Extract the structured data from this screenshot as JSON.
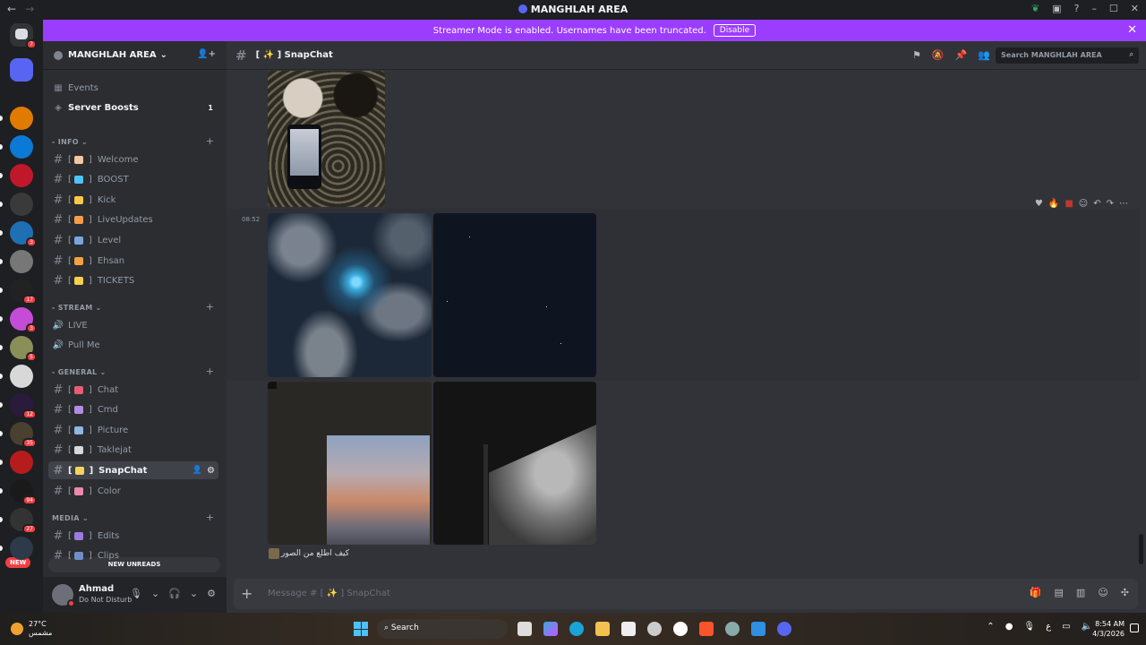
{
  "window": {
    "title": "MANGHLAH AREA",
    "back": "←",
    "forward": "→"
  },
  "banner": {
    "text": "Streamer Mode is enabled. Usernames have been truncated.",
    "disable_label": "Disable",
    "close": "✕"
  },
  "servers": {
    "dm_badge": "7",
    "new_label": "NEW",
    "items": [
      {
        "badge": "",
        "color": "#5865f2"
      },
      {
        "badge": "",
        "color": "#e07b00"
      },
      {
        "badge": "",
        "color": "#0b79d6"
      },
      {
        "badge": "",
        "color": "#c0182b"
      },
      {
        "badge": "",
        "color": "#3a3a3a"
      },
      {
        "badge": "3",
        "color": "#1f6fb5"
      },
      {
        "badge": "",
        "color": "#777777"
      },
      {
        "badge": "17",
        "color": "#222222"
      },
      {
        "badge": "3",
        "color": "#c44cd6"
      },
      {
        "badge": "5",
        "color": "#8a8f5a"
      },
      {
        "badge": "",
        "color": "#d8d8d8"
      },
      {
        "badge": "12",
        "color": "#2a1b3d"
      },
      {
        "badge": "35",
        "color": "#4a4030"
      },
      {
        "badge": "",
        "color": "#b71c1c"
      },
      {
        "badge": "94",
        "color": "#1a1a1a"
      },
      {
        "badge": "27",
        "color": "#333333"
      },
      {
        "badge": "",
        "color": "#2d3a4a"
      }
    ]
  },
  "guild": {
    "name": "MANGHLAH AREA",
    "chevron": "⌄"
  },
  "sidebar": {
    "events": "Events",
    "boosts": "Server Boosts",
    "boosts_count": "1",
    "cat_info": "INFO",
    "info_channels": [
      {
        "label": "Welcome",
        "emoji_color": "#f3c7a1"
      },
      {
        "label": "BOOST",
        "emoji_color": "#4fc3f7"
      },
      {
        "label": "Kick",
        "emoji_color": "#f9c846"
      },
      {
        "label": "LiveUpdates",
        "emoji_color": "#f39c4a"
      },
      {
        "label": "Level",
        "emoji_color": "#7aa6e0"
      },
      {
        "label": "Ehsan",
        "emoji_color": "#f5a142"
      },
      {
        "label": "TICKETS",
        "emoji_color": "#f6d04d"
      }
    ],
    "cat_stream": "STREAM",
    "stream_channels": [
      "LIVE",
      "Pull Me"
    ],
    "cat_general": "GENERAL",
    "general_channels": [
      {
        "label": "Chat",
        "emoji_color": "#e85d75"
      },
      {
        "label": "Cmd",
        "emoji_color": "#b08de0"
      },
      {
        "label": "Picture",
        "emoji_color": "#8fb7e0"
      },
      {
        "label": "Taklejat",
        "emoji_color": "#d9d9d9"
      },
      {
        "label": "SnapChat",
        "emoji_color": "#f8d25c"
      },
      {
        "label": "Color",
        "emoji_color": "#e98aa8"
      }
    ],
    "cat_media": "MEDIA",
    "media_channels": [
      {
        "label": "Edits",
        "emoji_color": "#9a7be0"
      },
      {
        "label": "Clips",
        "emoji_color": "#6f8ec8"
      }
    ],
    "new_unreads": "NEW UNREADS"
  },
  "user": {
    "name": "Ahmad",
    "status": "Do Not Disturb"
  },
  "channel": {
    "name": "[ ✨ ] SnapChat",
    "search_placeholder": "Search MANGHLAH AREA"
  },
  "message": {
    "time": "08:52",
    "caption": "كيف اطلع من الصور"
  },
  "composer": {
    "placeholder": "Message # [ ✨ ] SnapChat"
  },
  "taskbar": {
    "temp": "27°C",
    "weather_text": "مشمس",
    "search": "Search",
    "time": "8:54 AM",
    "date": "4/3/2026",
    "lang": "ع"
  }
}
